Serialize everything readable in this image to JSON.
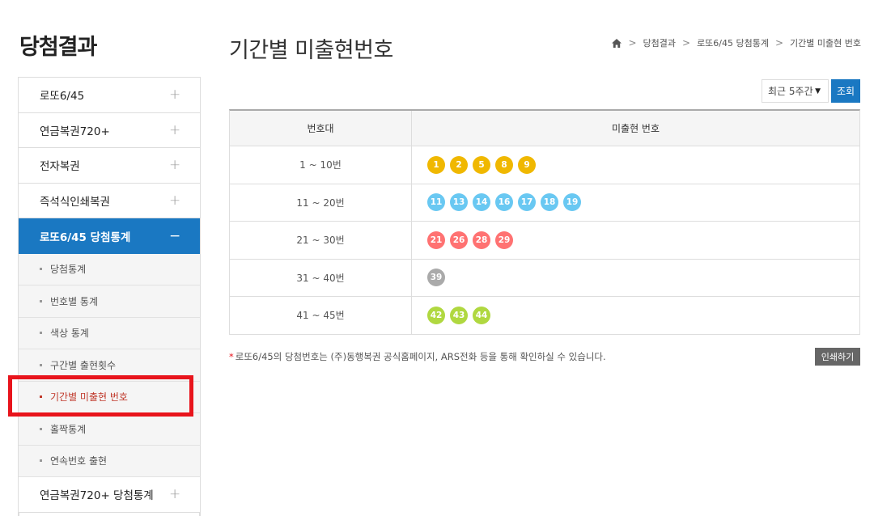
{
  "sidebar": {
    "title": "당첨결과",
    "items": [
      {
        "label": "로또6/45",
        "toggle": "+"
      },
      {
        "label": "연금복권720+",
        "toggle": "+"
      },
      {
        "label": "전자복권",
        "toggle": "+"
      },
      {
        "label": "즉석식인쇄복권",
        "toggle": "+"
      },
      {
        "label": "로또6/45 당첨통계",
        "toggle": "−"
      }
    ],
    "subitems": [
      {
        "label": "당첨통계"
      },
      {
        "label": "번호별 통계"
      },
      {
        "label": "색상 통계"
      },
      {
        "label": "구간별 출현횟수"
      },
      {
        "label": "기간별 미출현 번호"
      },
      {
        "label": "홀짝통계"
      },
      {
        "label": "연속번호 출현"
      }
    ],
    "last_item": {
      "label": "연금복권720+ 당첨통계",
      "toggle": "+"
    }
  },
  "header": {
    "title": "기간별 미출현번호",
    "breadcrumb": [
      "당첨결과",
      "로또6/45 당첨통계",
      "기간별 미출현 번호"
    ],
    "breadcrumb_sep": ">"
  },
  "filter": {
    "period_value": "최근 5주간",
    "period_caret": "▼",
    "query_label": "조회"
  },
  "table": {
    "headers": [
      "번호대",
      "미출현 번호"
    ],
    "rows": [
      {
        "range": "1 ~ 10번",
        "color": "#f0b800",
        "numbers": [
          "1",
          "2",
          "5",
          "8",
          "9"
        ]
      },
      {
        "range": "11 ~ 20번",
        "color": "#69c8f2",
        "numbers": [
          "11",
          "13",
          "14",
          "16",
          "17",
          "18",
          "19"
        ]
      },
      {
        "range": "21 ~ 30번",
        "color": "#ff7272",
        "numbers": [
          "21",
          "26",
          "28",
          "29"
        ]
      },
      {
        "range": "31 ~ 40번",
        "color": "#aaaaaa",
        "numbers": [
          "39"
        ]
      },
      {
        "range": "41 ~ 45번",
        "color": "#b0d840",
        "numbers": [
          "42",
          "43",
          "44"
        ]
      }
    ]
  },
  "footer": {
    "note_star": "*",
    "note": "로또6/45의 당첨번호는 (주)동행복권 공식홈페이지, ARS전화 등을 통해 확인하실 수 있습니다.",
    "print_label": "인쇄하기"
  }
}
